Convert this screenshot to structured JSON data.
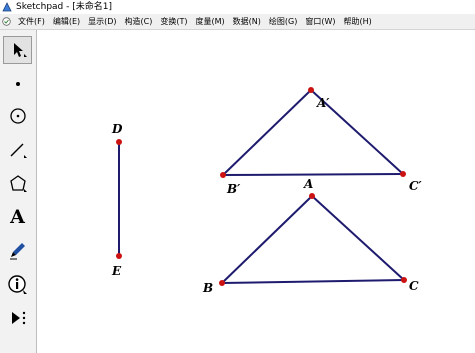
{
  "window": {
    "title": "Sketchpad  - [未命名1]"
  },
  "menu": [
    "文件(F)",
    "编辑(E)",
    "显示(D)",
    "构造(C)",
    "变换(T)",
    "度量(M)",
    "数据(N)",
    "绘图(G)",
    "窗口(W)",
    "帮助(H)"
  ],
  "tools": [
    {
      "name": "arrow-selection-tool",
      "icon": "arrow-icon",
      "active": true
    },
    {
      "name": "point-tool",
      "icon": "point-icon"
    },
    {
      "name": "compass-tool",
      "icon": "circle-icon"
    },
    {
      "name": "straightedge-tool",
      "icon": "line-icon"
    },
    {
      "name": "polygon-tool",
      "icon": "pentagon-icon"
    },
    {
      "name": "text-tool",
      "icon": "text-a-icon",
      "glyph": "A"
    },
    {
      "name": "marker-tool",
      "icon": "pen-icon"
    },
    {
      "name": "information-tool",
      "icon": "info-icon"
    },
    {
      "name": "custom-tool",
      "icon": "play-more-icon"
    }
  ],
  "canvas": {
    "labels": {
      "D": "D",
      "E": "E",
      "A_prime": "A′",
      "B_prime": "B′",
      "C_prime": "C′",
      "A": "A",
      "B": "B",
      "C": "C"
    },
    "colors": {
      "segment": "#1e1b6e",
      "point": "#cc1111"
    }
  }
}
